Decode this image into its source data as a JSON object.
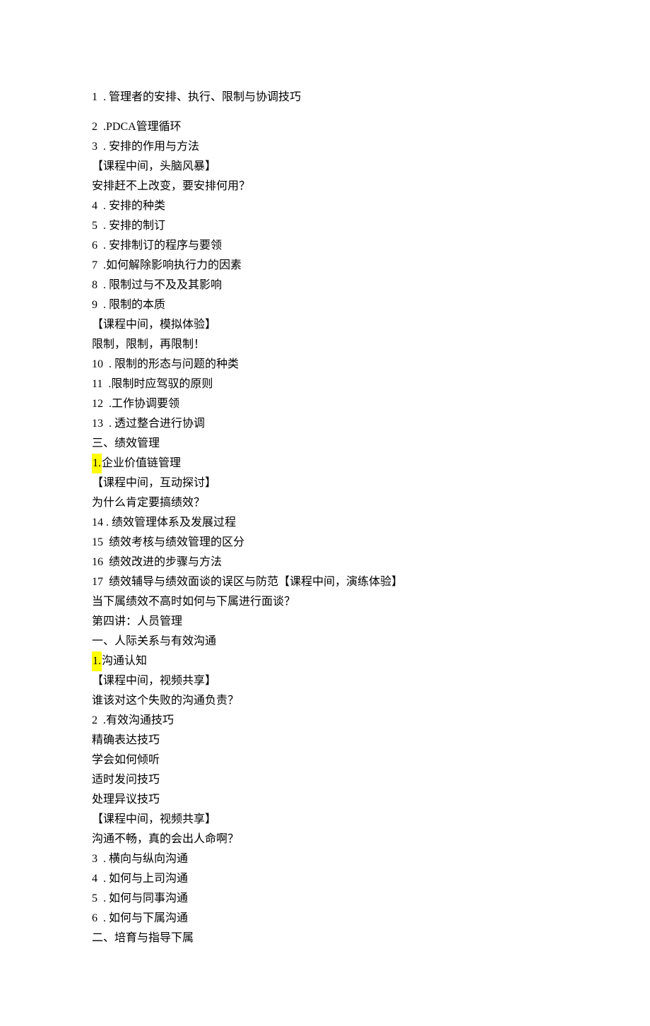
{
  "lines": [
    {
      "type": "numbered",
      "num": "1",
      "sep": "  . ",
      "text": "管理者的安排、执行、限制与协调技巧",
      "gapTop": true
    },
    {
      "type": "blank"
    },
    {
      "type": "numbered",
      "num": "2",
      "sep": "  .",
      "text": "PDCA管理循环"
    },
    {
      "type": "numbered",
      "num": "3",
      "sep": "  . ",
      "text": "安排的作用与方法"
    },
    {
      "type": "plain",
      "text": "【课程中间，头脑风暴】"
    },
    {
      "type": "plain",
      "text": "安排赶不上改变，要安排何用？"
    },
    {
      "type": "numbered",
      "num": "4",
      "sep": "  . ",
      "text": "安排的种类"
    },
    {
      "type": "numbered",
      "num": "5",
      "sep": "  . ",
      "text": "安排的制订"
    },
    {
      "type": "numbered",
      "num": "6",
      "sep": "  . ",
      "text": "安排制订的程序与要领"
    },
    {
      "type": "numbered",
      "num": "7",
      "sep": "  .",
      "text": "如何解除影响执行力的因素"
    },
    {
      "type": "numbered",
      "num": "8",
      "sep": "  . ",
      "text": "限制过与不及及其影响"
    },
    {
      "type": "numbered",
      "num": "9",
      "sep": "  . ",
      "text": "限制的本质"
    },
    {
      "type": "plain",
      "text": "【课程中间，模拟体验】"
    },
    {
      "type": "plain",
      "text": "限制，限制，再限制！"
    },
    {
      "type": "numbered",
      "num": "10",
      "sep": "  . ",
      "text": "限制的形态与问题的种类"
    },
    {
      "type": "numbered",
      "num": "11",
      "sep": "  .",
      "text": "限制时应驾驭的原则"
    },
    {
      "type": "numbered",
      "num": "12",
      "sep": "  .",
      "text": "工作协调要领"
    },
    {
      "type": "numbered",
      "num": "13",
      "sep": "  . ",
      "text": "透过整合进行协调"
    },
    {
      "type": "plain",
      "text": "三、绩效管理"
    },
    {
      "type": "highlight",
      "highlight": "1.",
      "text": "企业价值链管理"
    },
    {
      "type": "plain",
      "text": "【课程中间，互动探讨】"
    },
    {
      "type": "plain",
      "text": "为什么肯定要搞绩效？"
    },
    {
      "type": "numbered",
      "num": "14",
      "sep": " . ",
      "text": "绩效管理体系及发展过程"
    },
    {
      "type": "numbered",
      "num": "15",
      "sep": "  ",
      "text": "绩效考核与绩效管理的区分"
    },
    {
      "type": "numbered",
      "num": "16",
      "sep": "  ",
      "text": "绩效改进的步骤与方法"
    },
    {
      "type": "numbered",
      "num": "17",
      "sep": "  ",
      "text": "绩效辅导与绩效面谈的误区与防范【课程中间，演练体验】"
    },
    {
      "type": "plain",
      "text": "当下属绩效不高时如何与下属进行面谈？"
    },
    {
      "type": "plain",
      "text": "第四讲：人员管理"
    },
    {
      "type": "plain",
      "text": "一、人际关系与有效沟通"
    },
    {
      "type": "highlight",
      "highlight": "1.",
      "text": "沟通认知"
    },
    {
      "type": "plain",
      "text": "【课程中间，视频共享】"
    },
    {
      "type": "plain",
      "text": "谁该对这个失败的沟通负责？"
    },
    {
      "type": "numbered",
      "num": "2",
      "sep": "  .",
      "text": "有效沟通技巧"
    },
    {
      "type": "plain",
      "text": "精确表达技巧"
    },
    {
      "type": "plain",
      "text": "学会如何倾听"
    },
    {
      "type": "plain",
      "text": "适时发问技巧"
    },
    {
      "type": "plain",
      "text": "处理异议技巧"
    },
    {
      "type": "plain",
      "text": "【课程中间，视频共享】"
    },
    {
      "type": "plain",
      "text": "沟通不畅，真的会出人命啊？"
    },
    {
      "type": "numbered",
      "num": "3",
      "sep": "  . ",
      "text": "横向与纵向沟通"
    },
    {
      "type": "numbered",
      "num": "4",
      "sep": "  . ",
      "text": "如何与上司沟通"
    },
    {
      "type": "numbered",
      "num": "5",
      "sep": "  . ",
      "text": "如何与同事沟通"
    },
    {
      "type": "numbered",
      "num": "6",
      "sep": "  . ",
      "text": "如何与下属沟通"
    },
    {
      "type": "plain",
      "text": "二、培育与指导下属"
    }
  ]
}
